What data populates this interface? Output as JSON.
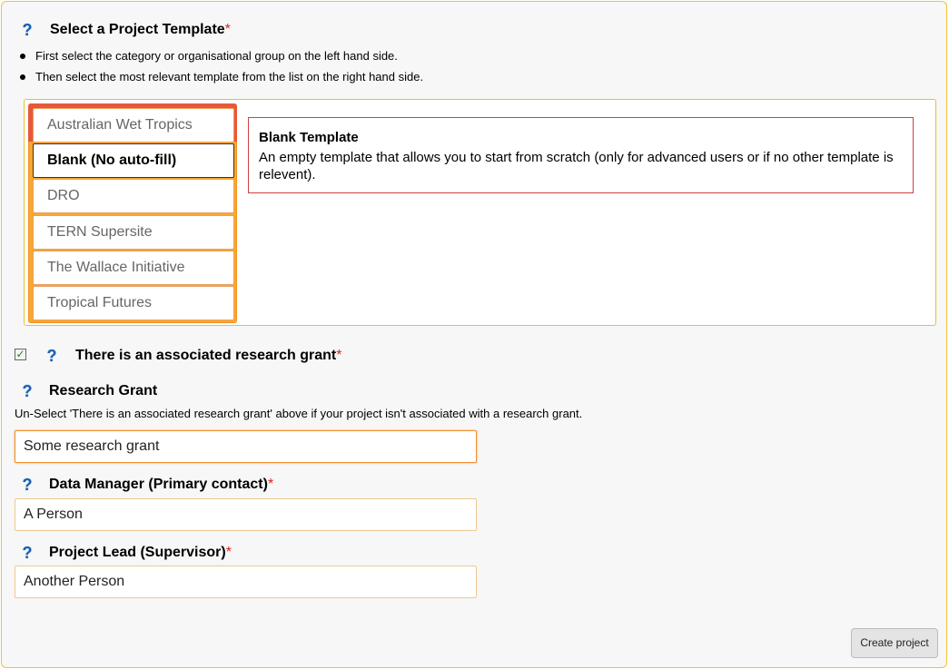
{
  "section_template": {
    "help_icon": "question-mark-icon",
    "title": "Select a Project Template",
    "required_marker": "*",
    "instructions": [
      "First select the category or organisational group on the left hand side.",
      "Then select the most relevant template from the list on the right hand side."
    ],
    "templates": [
      "Australian Wet Tropics",
      "Blank (No auto-fill)",
      "DRO",
      "TERN Supersite",
      "The Wallace Initiative",
      "Tropical Futures"
    ],
    "selected_template": "Blank (No auto-fill)",
    "description": {
      "title": "Blank Template",
      "text": "An empty template that allows you to start from scratch (only for advanced users or if no other template is relevent)."
    }
  },
  "grant_checkbox": {
    "checked": true,
    "check_icon": "checkmark-icon",
    "label": "There is an associated research grant",
    "required_marker": "*"
  },
  "research_grant": {
    "label": "Research Grant",
    "hint": "Un-Select 'There is an associated research grant' above if your project isn't associated with a research grant.",
    "value": "Some research grant"
  },
  "data_manager": {
    "label": "Data Manager (Primary contact)",
    "required_marker": "*",
    "value": "A Person"
  },
  "project_lead": {
    "label": "Project Lead (Supervisor)",
    "required_marker": "*",
    "value": "Another Person"
  },
  "actions": {
    "create_label": "Create project"
  },
  "colors": {
    "frame_border": "#f0c040",
    "required": "#e02020",
    "help_icon": "#1a5fb4",
    "list_orange": "#f8a830",
    "list_red": "#e85838",
    "desc_border": "#d04040",
    "check": "#1b8a1b"
  }
}
